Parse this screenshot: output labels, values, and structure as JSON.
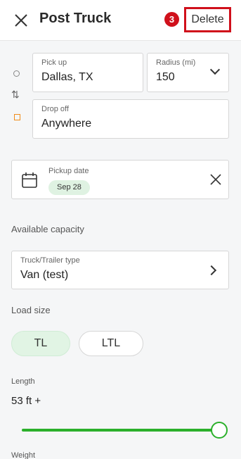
{
  "header": {
    "title": "Post Truck",
    "badge_count": "3",
    "delete_label": "Delete"
  },
  "pickup": {
    "label": "Pick up",
    "value": "Dallas, TX"
  },
  "radius": {
    "label": "Radius (mi)",
    "value": "150"
  },
  "dropoff": {
    "label": "Drop off",
    "value": "Anywhere"
  },
  "pickup_date": {
    "label": "Pickup date",
    "chip": "Sep 28"
  },
  "capacity": {
    "section_label": "Available capacity"
  },
  "truck_type": {
    "label": "Truck/Trailer type",
    "value": "Van (test)"
  },
  "load_size": {
    "section_label": "Load size",
    "options": [
      "TL",
      "LTL"
    ],
    "selected": "TL"
  },
  "length": {
    "label": "Length",
    "value": "53 ft +",
    "slider_fraction": 1.0
  },
  "weight": {
    "label": "Weight"
  },
  "colors": {
    "accent_green": "#2bb02b",
    "highlight_red": "#d0101b",
    "dropoff_orange": "#f08c1a"
  }
}
